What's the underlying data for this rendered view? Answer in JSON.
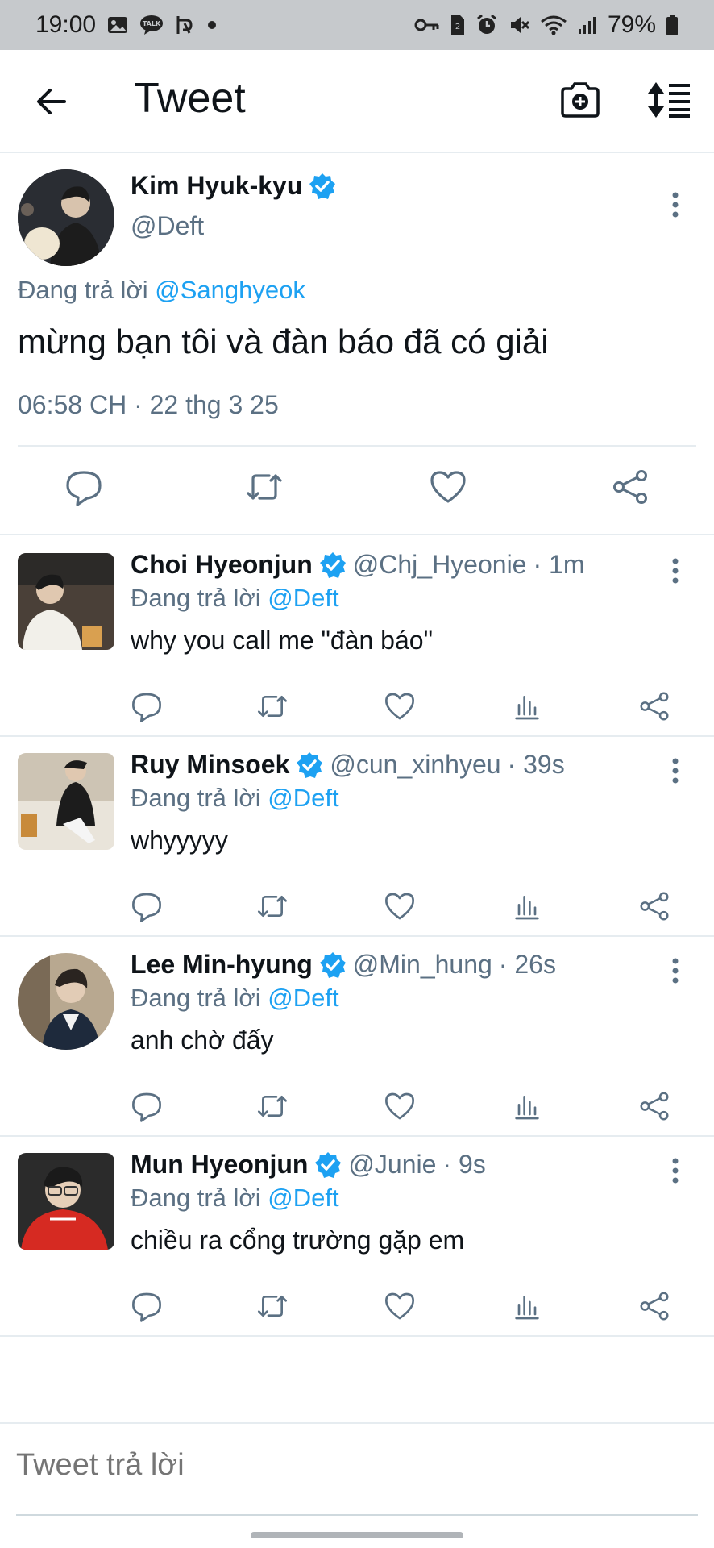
{
  "status_bar": {
    "time": "19:00",
    "left_icons": [
      "gallery-icon",
      "talk-icon",
      "translate-icon",
      "dot-icon"
    ],
    "right_icons": [
      "key-icon",
      "sim-icon",
      "alarm-icon",
      "mute-icon",
      "wifi-icon",
      "signal-icon"
    ],
    "battery": "79%"
  },
  "app_bar": {
    "title": "Tweet",
    "back_icon": "arrow-left-icon",
    "camera_icon": "camera-plus-icon",
    "sort_icon": "sort-icon"
  },
  "main_tweet": {
    "display_name": "Kim Hyuk-kyu",
    "handle": "@Deft",
    "reply_prefix": "Đang trả lời",
    "reply_to": "@Sanghyeok",
    "text": "mừng bạn tôi và đàn báo đã có giải",
    "timestamp": "06:58 CH · 22 thg 3 25",
    "actions": [
      "reply-icon",
      "retweet-icon",
      "like-icon",
      "share-icon"
    ]
  },
  "replies": [
    {
      "display_name": "Choi Hyeonjun",
      "handle": "@Chj_Hyeonie",
      "time": "· 1m",
      "reply_prefix": "Đang trả lời",
      "reply_to": "@Deft",
      "text": "why you call me \"đàn báo\""
    },
    {
      "display_name": "Ruy Minsoek",
      "handle": "@cun_xinhyeu",
      "time": "· 39s",
      "reply_prefix": "Đang trả lời",
      "reply_to": "@Deft",
      "text": "whyyyyy"
    },
    {
      "display_name": "Lee Min-hyung",
      "handle": "@Min_hung",
      "time": "· 26s",
      "reply_prefix": "Đang trả lời",
      "reply_to": "@Deft",
      "text": "anh chờ đấy"
    },
    {
      "display_name": "Mun Hyeonjun",
      "handle": "@Junie",
      "time": "· 9s",
      "reply_prefix": "Đang trả lời",
      "reply_to": "@Deft",
      "text": "chiều ra cổng trường gặp em"
    }
  ],
  "composer": {
    "placeholder": "Tweet trả lời"
  },
  "colors": {
    "accent": "#1da1f2",
    "secondary_text": "#5b7083",
    "status_bar_bg": "#c6c9cc"
  }
}
